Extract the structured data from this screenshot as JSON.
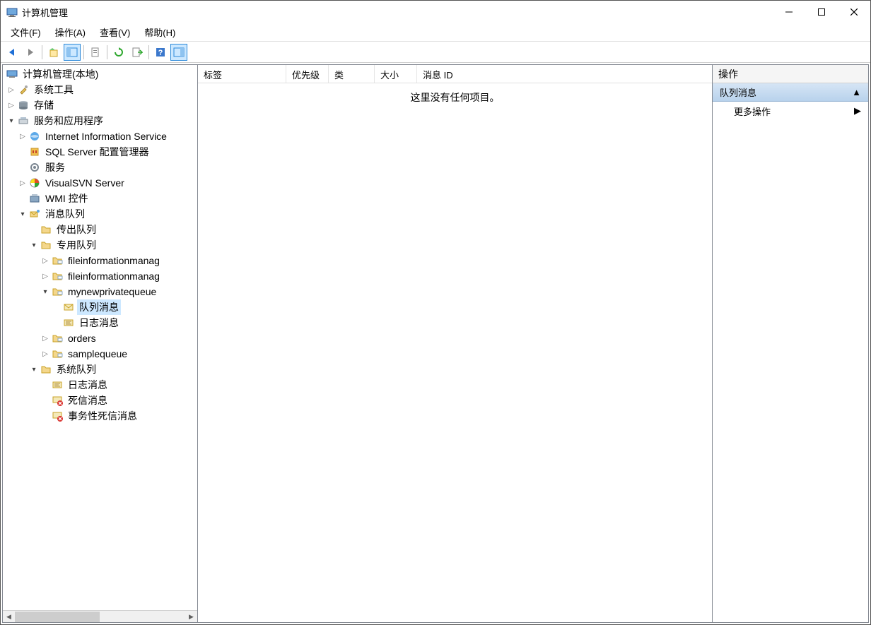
{
  "window": {
    "title": "计算机管理"
  },
  "menu": {
    "file": "文件(F)",
    "action": "操作(A)",
    "view": "查看(V)",
    "help": "帮助(H)"
  },
  "tree": {
    "root": "计算机管理(本地)",
    "systemTools": "系统工具",
    "storage": "存储",
    "servicesApps": "服务和应用程序",
    "iis": "Internet Information Service",
    "sqlServer": "SQL Server 配置管理器",
    "services": "服务",
    "visualsvn": "VisualSVN Server",
    "wmi": "WMI 控件",
    "msgQueue": "消息队列",
    "outgoing": "传出队列",
    "private": "专用队列",
    "fim1": "fileinformationmanag",
    "fim2": "fileinformationmanag",
    "mynew": "mynewprivatequeue",
    "queueMsg": "队列消息",
    "logMsg": "日志消息",
    "orders": "orders",
    "sample": "samplequeue",
    "systemQueue": "系统队列",
    "sysLogMsg": "日志消息",
    "dead": "死信消息",
    "txnDead": "事务性死信消息"
  },
  "columns": {
    "label": "标签",
    "priority": "优先级",
    "class": "类",
    "size": "大小",
    "msgId": "消息 ID"
  },
  "empty": "这里没有任何项目。",
  "actions": {
    "header": "操作",
    "section": "队列消息",
    "more": "更多操作"
  }
}
